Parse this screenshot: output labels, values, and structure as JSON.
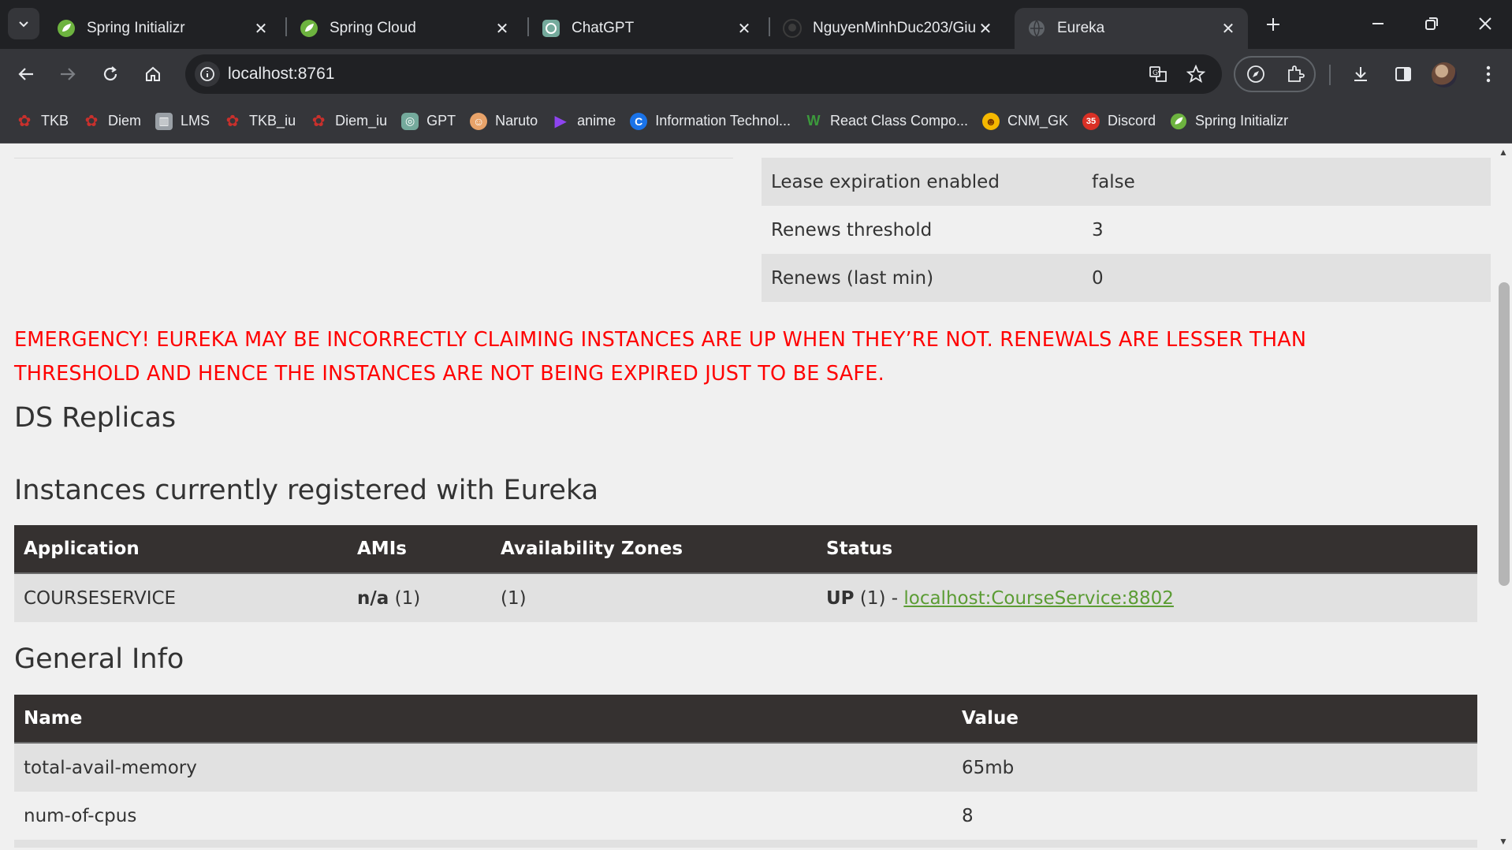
{
  "browser": {
    "tabs": [
      {
        "label": "Spring Initializr",
        "icon": "spring-leaf-icon"
      },
      {
        "label": "Spring Cloud",
        "icon": "spring-leaf-icon"
      },
      {
        "label": "ChatGPT",
        "icon": "chatgpt-icon"
      },
      {
        "label": "NguyenMinhDuc203/Giu",
        "icon": "github-icon"
      },
      {
        "label": "Eureka",
        "icon": "globe-icon"
      }
    ],
    "url": "localhost:8761",
    "bookmarks": [
      {
        "label": "TKB",
        "icon": "maple-leaf-icon",
        "color": "#c9302c"
      },
      {
        "label": "Diem",
        "icon": "maple-leaf-icon",
        "color": "#c9302c"
      },
      {
        "label": "LMS",
        "icon": "lms-icon",
        "color": "#9aa0a6"
      },
      {
        "label": "TKB_iu",
        "icon": "maple-leaf-icon",
        "color": "#c9302c"
      },
      {
        "label": "Diem_iu",
        "icon": "maple-leaf-icon",
        "color": "#c9302c"
      },
      {
        "label": "GPT",
        "icon": "chatgpt-icon",
        "color": "#74aa9c"
      },
      {
        "label": "Naruto",
        "icon": "naruto-icon",
        "color": "#e8a36a"
      },
      {
        "label": "anime",
        "icon": "play-icon",
        "color": "#8e44ef"
      },
      {
        "label": "Information Technol...",
        "icon": "c-logo-icon",
        "color": "#1a73e8"
      },
      {
        "label": "React Class Compo...",
        "icon": "w-logo-icon",
        "color": "#3c9a3c"
      },
      {
        "label": "CNM_GK",
        "icon": "emoji-icon",
        "color": "#f5b800"
      },
      {
        "label": "Discord",
        "icon": "calendar-badge-icon",
        "color": "#d93025",
        "badge": "35"
      },
      {
        "label": "Spring Initializr",
        "icon": "spring-leaf-icon",
        "color": "#6db33f"
      }
    ]
  },
  "lease": [
    {
      "key": "Lease expiration enabled",
      "value": "false"
    },
    {
      "key": "Renews threshold",
      "value": "3"
    },
    {
      "key": "Renews (last min)",
      "value": "0"
    }
  ],
  "emergency": {
    "line1": "EMERGENCY! EUREKA MAY BE INCORRECTLY CLAIMING INSTANCES ARE UP WHEN THEY’RE NOT. RENEWALS ARE LESSER THAN",
    "line2": "THRESHOLD AND HENCE THE INSTANCES ARE NOT BEING EXPIRED JUST TO BE SAFE."
  },
  "ds_replicas": {
    "title": "DS Replicas"
  },
  "instances": {
    "title": "Instances currently registered with Eureka",
    "headers": [
      "Application",
      "AMIs",
      "Availability Zones",
      "Status"
    ],
    "rows": [
      {
        "application": "COURSESERVICE",
        "amis_bold": "n/a",
        "amis_count": " (1)",
        "zones": "(1)",
        "status_bold": "UP",
        "status_text": " (1) - ",
        "status_link": "localhost:CourseService:8802"
      }
    ]
  },
  "general_info": {
    "title": "General Info",
    "headers": [
      "Name",
      "Value"
    ],
    "rows": [
      {
        "name": "total-avail-memory",
        "value": "65mb"
      },
      {
        "name": "num-of-cpus",
        "value": "8"
      }
    ]
  },
  "colors": {
    "emergency": "#ff0000",
    "table_header": "#353130",
    "link": "#5b9c34",
    "spring": "#6db33f"
  }
}
